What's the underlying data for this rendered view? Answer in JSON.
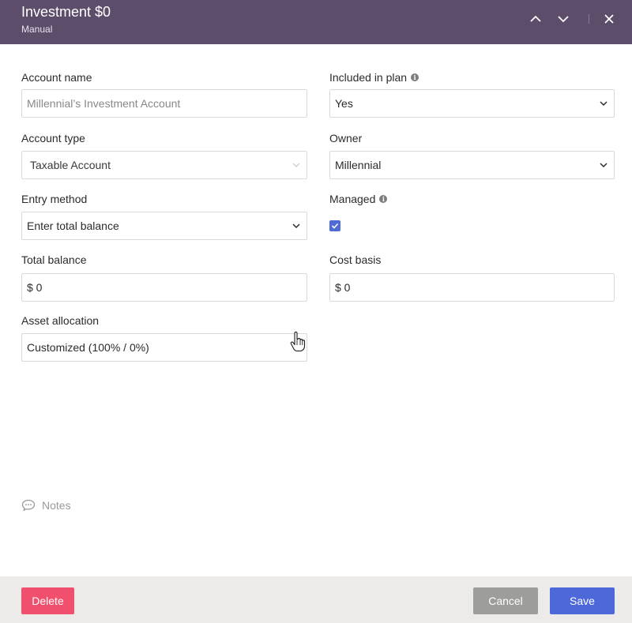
{
  "header": {
    "title": "Investment $0",
    "subtitle": "Manual"
  },
  "form": {
    "account_name": {
      "label": "Account name",
      "placeholder": "Millennial’s Investment Account"
    },
    "included_in_plan": {
      "label": "Included in plan",
      "value": "Yes"
    },
    "account_type": {
      "label": "Account type",
      "value": "Taxable Account"
    },
    "owner": {
      "label": "Owner",
      "value": "Millennial"
    },
    "entry_method": {
      "label": "Entry method",
      "value": "Enter total balance"
    },
    "managed": {
      "label": "Managed",
      "checked": true
    },
    "total_balance": {
      "label": "Total balance",
      "value": "$ 0"
    },
    "cost_basis": {
      "label": "Cost basis",
      "value": "$ 0"
    },
    "asset_allocation": {
      "label": "Asset allocation",
      "value": "Customized (100% / 0%)"
    }
  },
  "notes": {
    "label": "Notes"
  },
  "footer": {
    "delete_label": "Delete",
    "cancel_label": "Cancel",
    "save_label": "Save"
  },
  "colors": {
    "header_bg": "#5c4d6b",
    "delete": "#f0506e",
    "cancel": "#9d9d9b",
    "save": "#4d68d8",
    "checkbox": "#4e6bd6"
  }
}
